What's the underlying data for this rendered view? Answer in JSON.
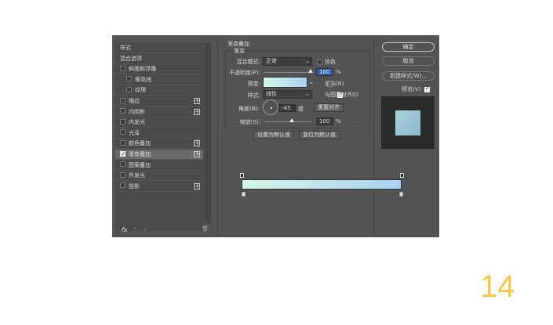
{
  "sidebar": {
    "items": [
      {
        "label": "样式",
        "check": false,
        "box": false
      },
      {
        "label": "混合选项",
        "check": false,
        "box": false
      },
      {
        "label": "斜面和浮雕",
        "box": true,
        "plus": false
      },
      {
        "label": "等高线",
        "box": true,
        "indent": true
      },
      {
        "label": "纹理",
        "box": true,
        "indent": true
      },
      {
        "label": "描边",
        "box": true,
        "plus": true
      },
      {
        "label": "内阴影",
        "box": true,
        "plus": true
      },
      {
        "label": "内发光",
        "box": true
      },
      {
        "label": "光泽",
        "box": true
      },
      {
        "label": "颜色叠加",
        "box": true,
        "plus": true
      },
      {
        "label": "渐变叠加",
        "box": true,
        "check": true,
        "plus": true,
        "selected": true
      },
      {
        "label": "图案叠加",
        "box": true
      },
      {
        "label": "外发光",
        "box": true
      },
      {
        "label": "投影",
        "box": true,
        "plus": true
      }
    ],
    "fx": "fx"
  },
  "panel": {
    "title": "渐变叠加",
    "group": "渐变",
    "blend_label": "混合模式:",
    "blend_value": "正常",
    "dither": "仿色",
    "opacity_label": "不透明度(P):",
    "opacity_value": "100",
    "opacity_unit": "%",
    "gradient_label": "渐变:",
    "reverse": "反向(R)",
    "style_label": "样式:",
    "style_value": "线性",
    "align": "与图层对齐(I)",
    "angle_label": "角度(N):",
    "angle_value": "-45",
    "angle_unit": "度",
    "reset_align": "重置对齐",
    "scale_label": "缩放(S):",
    "scale_value": "100",
    "scale_unit": "%",
    "set_default": "设置为默认值",
    "reset_default": "复位为默认值"
  },
  "buttons": {
    "ok": "确定",
    "cancel": "取消",
    "new_style": "新建样式(W)...",
    "preview": "预览(V)"
  },
  "gradient_colors": [
    "#d2f7e6",
    "#aad2f5"
  ],
  "page_number": "14"
}
